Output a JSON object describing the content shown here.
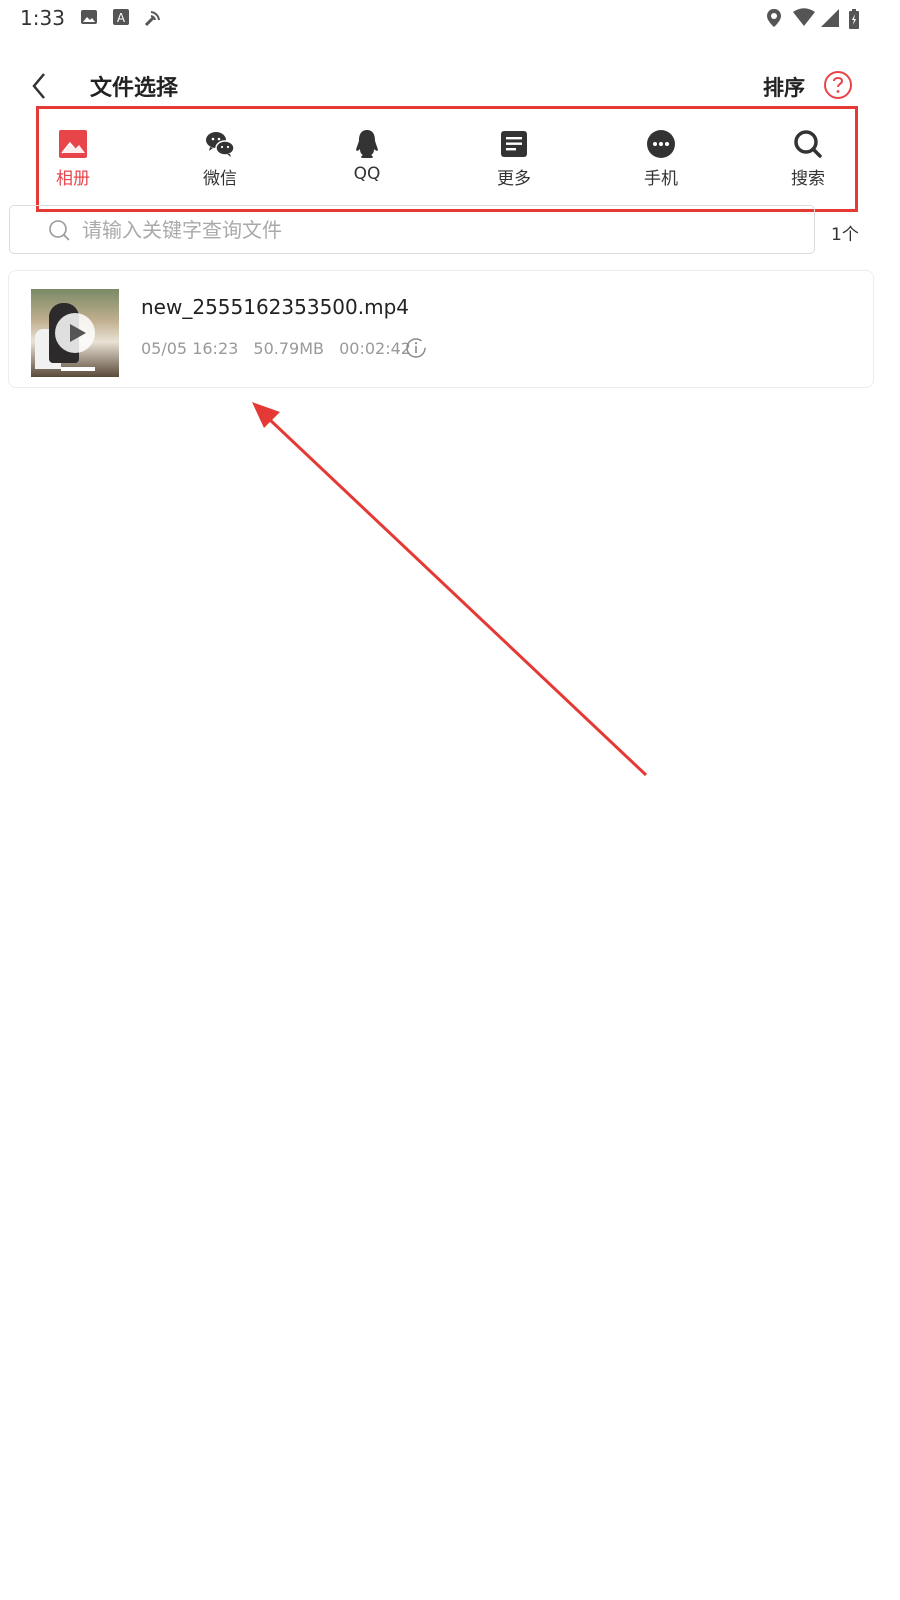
{
  "status_bar": {
    "time": "1:33",
    "icons": [
      "image-icon",
      "font-icon",
      "signal-broadcast-icon",
      "location-icon",
      "wifi-icon",
      "cell-signal-icon",
      "battery-icon"
    ]
  },
  "header": {
    "title": "文件选择",
    "sort_label": "排序",
    "back_icon": "chevron-left-icon",
    "help_icon": "question-circle-icon"
  },
  "tabs": [
    {
      "label": "相册",
      "icon": "image-icon",
      "active": true
    },
    {
      "label": "微信",
      "icon": "wechat-icon",
      "active": false
    },
    {
      "label": "QQ",
      "icon": "qq-penguin-icon",
      "active": false
    },
    {
      "label": "更多",
      "icon": "document-icon",
      "active": false
    },
    {
      "label": "手机",
      "icon": "more-dots-icon",
      "active": false
    },
    {
      "label": "搜索",
      "icon": "search-icon",
      "active": false
    }
  ],
  "search": {
    "placeholder": "请输入关键字查询文件",
    "count": "1个"
  },
  "files": [
    {
      "name": "new_2555162353500.mp4",
      "date": "05/05 16:23",
      "size": "50.79MB",
      "duration": "00:02:42"
    }
  ],
  "colors": {
    "accent": "#e8454a",
    "annotation": "#e53935",
    "text": "#222222",
    "muted": "#999999"
  }
}
